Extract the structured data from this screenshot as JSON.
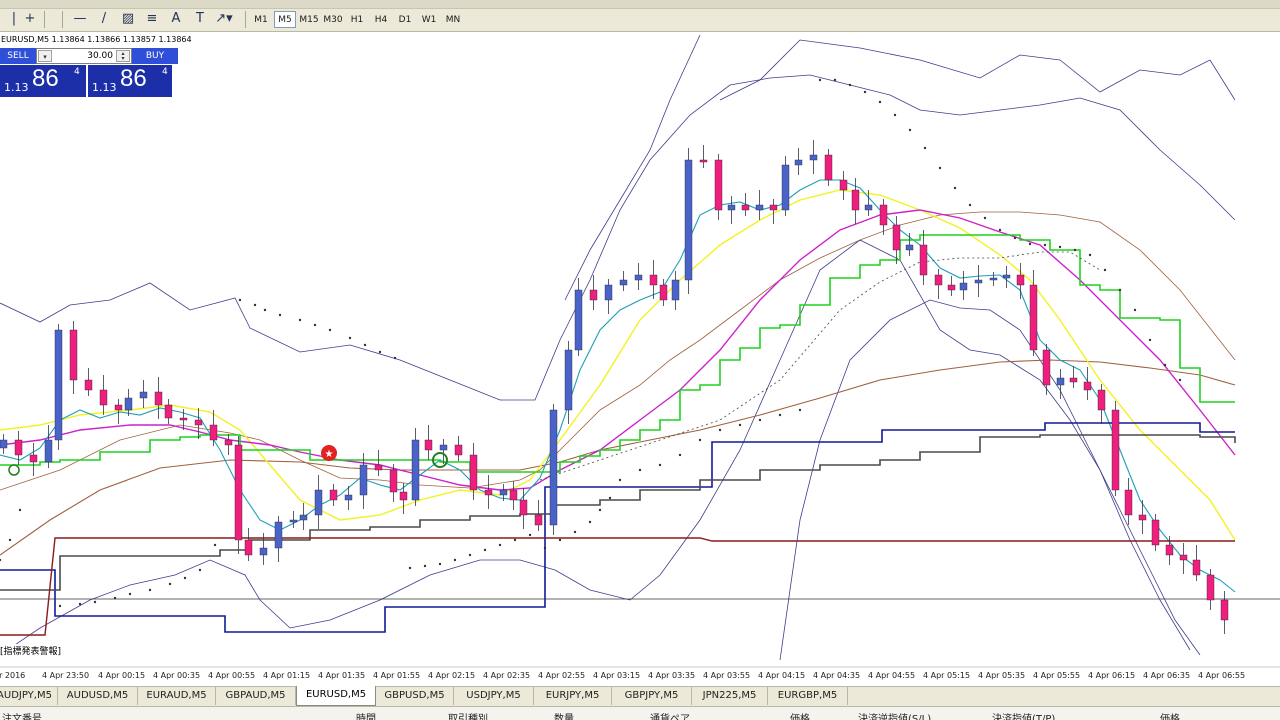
{
  "toolbar": {
    "tools": [
      {
        "name": "vertical-line-icon",
        "glyph": "|"
      },
      {
        "name": "crosshair-icon",
        "glyph": "+"
      },
      {
        "name": "horizontal-line-icon",
        "glyph": "—"
      },
      {
        "name": "trendline-icon",
        "glyph": "/"
      },
      {
        "name": "channel-icon",
        "glyph": "▨"
      },
      {
        "name": "fibonacci-icon",
        "glyph": "≡"
      },
      {
        "name": "text-icon",
        "glyph": "A"
      },
      {
        "name": "text-label-icon",
        "glyph": "T"
      },
      {
        "name": "arrows-dropdown-icon",
        "glyph": "↗▾"
      }
    ],
    "timeframes": [
      "M1",
      "M5",
      "M15",
      "M30",
      "H1",
      "H4",
      "D1",
      "W1",
      "MN"
    ],
    "active_timeframe": "M5"
  },
  "chart": {
    "symbol_label": "EURUSD,M5  1.13864 1.13866 1.13857 1.13864",
    "one_click": {
      "sell_label": "SELL",
      "buy_label": "BUY",
      "lot": "30.00",
      "lot_dropdown_glyph": "▾",
      "sell_price": {
        "prefix": "1.13",
        "big": "86",
        "sup": "4"
      },
      "buy_price": {
        "prefix": "1.13",
        "big": "86",
        "sup": "4"
      }
    },
    "news_label": "[指標発表警報]",
    "time_axis": [
      "pr 2016",
      "4 Apr 23:50",
      "4 Apr 00:15",
      "4 Apr 00:35",
      "4 Apr 00:55",
      "4 Apr 01:15",
      "4 Apr 01:35",
      "4 Apr 01:55",
      "4 Apr 02:15",
      "4 Apr 02:35",
      "4 Apr 02:55",
      "4 Apr 03:15",
      "4 Apr 03:35",
      "4 Apr 03:55",
      "4 Apr 04:15",
      "4 Apr 04:35",
      "4 Apr 04:55",
      "4 Apr 05:15",
      "4 Apr 05:35",
      "4 Apr 05:55",
      "4 Apr 06:15",
      "4 Apr 06:35",
      "4 Apr 06:55"
    ],
    "colors": {
      "bull_candle": "#4a63c9",
      "bear_candle": "#ef1f7e",
      "bollinger": "#3d3d8c",
      "fast_ma": "#1e9fb9",
      "yellow_ma": "#f2f222",
      "magenta_ma": "#cc22cc",
      "green_line": "#1ed21e",
      "brown_ma": "#a06040",
      "navy_line": "#101a9a",
      "gray_line": "#4a4a4a",
      "dark_red_line": "#8b1a1a",
      "sar_dots": "#333333"
    }
  },
  "symbol_tabs": [
    "AUDJPY,M5",
    "AUDUSD,M5",
    "EURAUD,M5",
    "GBPAUD,M5",
    "EURUSD,M5",
    "GBPUSD,M5",
    "USDJPY,M5",
    "EURJPY,M5",
    "GBPJPY,M5",
    "JPN225,M5",
    "EURGBP,M5"
  ],
  "active_tab": "EURUSD,M5",
  "terminal_columns": [
    "注文番号",
    "時間",
    "取引種別",
    "数量",
    "通貨ペア",
    "価格",
    "決済逆指値(S/L)",
    "決済指値(T/P)",
    "価格"
  ]
}
